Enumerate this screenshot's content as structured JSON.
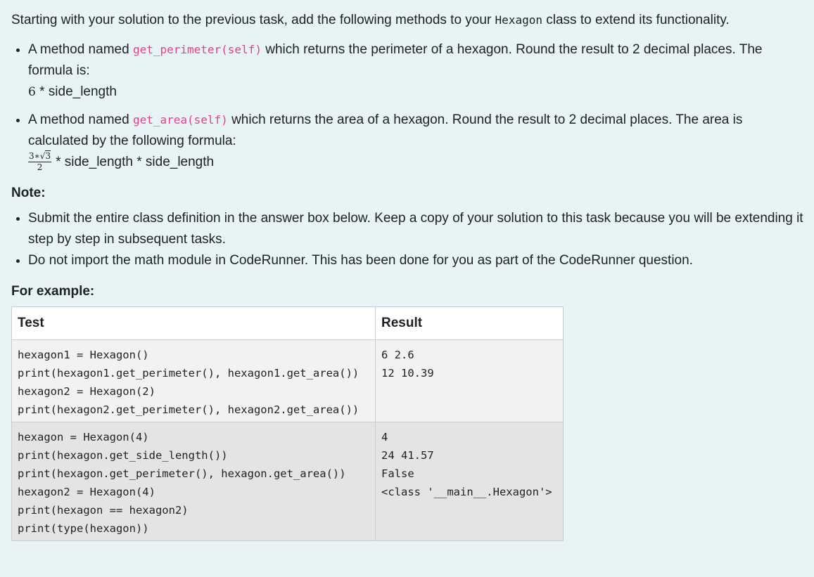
{
  "intro": {
    "before": "Starting with your solution to the previous task, add the following methods to your ",
    "class_name": "Hexagon",
    "after": " class to extend its functionality."
  },
  "requirements": [
    {
      "prefix": "A method named ",
      "method": "get_perimeter(self)",
      "suffix": " which returns the perimeter of a hexagon. Round the result to 2 decimal places. The formula is:",
      "formula_number": "6",
      "formula_text": " * side_length"
    },
    {
      "prefix": "A method named ",
      "method": "get_area(self)",
      "suffix": " which returns the area of a hexagon. Round the result to 2 decimal places. The area is calculated by the following formula:",
      "fraction_numerator_left": "3∗",
      "fraction_numerator_root": "√",
      "fraction_numerator_radicand": "3",
      "fraction_denominator": "2",
      "formula_text": "* side_length * side_length"
    }
  ],
  "note": {
    "heading": "Note:",
    "items": [
      "Submit the entire class definition in the answer box below. Keep a copy of your solution to this task because you will be extending it step by step in subsequent tasks.",
      "Do not import the math module in CodeRunner. This has been done for you as part of the CodeRunner question."
    ]
  },
  "example": {
    "heading": "For example:",
    "columns": [
      "Test",
      "Result"
    ],
    "rows": [
      {
        "test": "hexagon1 = Hexagon()\nprint(hexagon1.get_perimeter(), hexagon1.get_area())\nhexagon2 = Hexagon(2)\nprint(hexagon2.get_perimeter(), hexagon2.get_area())",
        "result": "6 2.6\n12 10.39"
      },
      {
        "test": "hexagon = Hexagon(4)\nprint(hexagon.get_side_length())\nprint(hexagon.get_perimeter(), hexagon.get_area())\nhexagon2 = Hexagon(4)\nprint(hexagon == hexagon2)\nprint(type(hexagon))",
        "result": "4\n24 41.57\nFalse\n<class '__main__.Hexagon'>"
      }
    ]
  }
}
